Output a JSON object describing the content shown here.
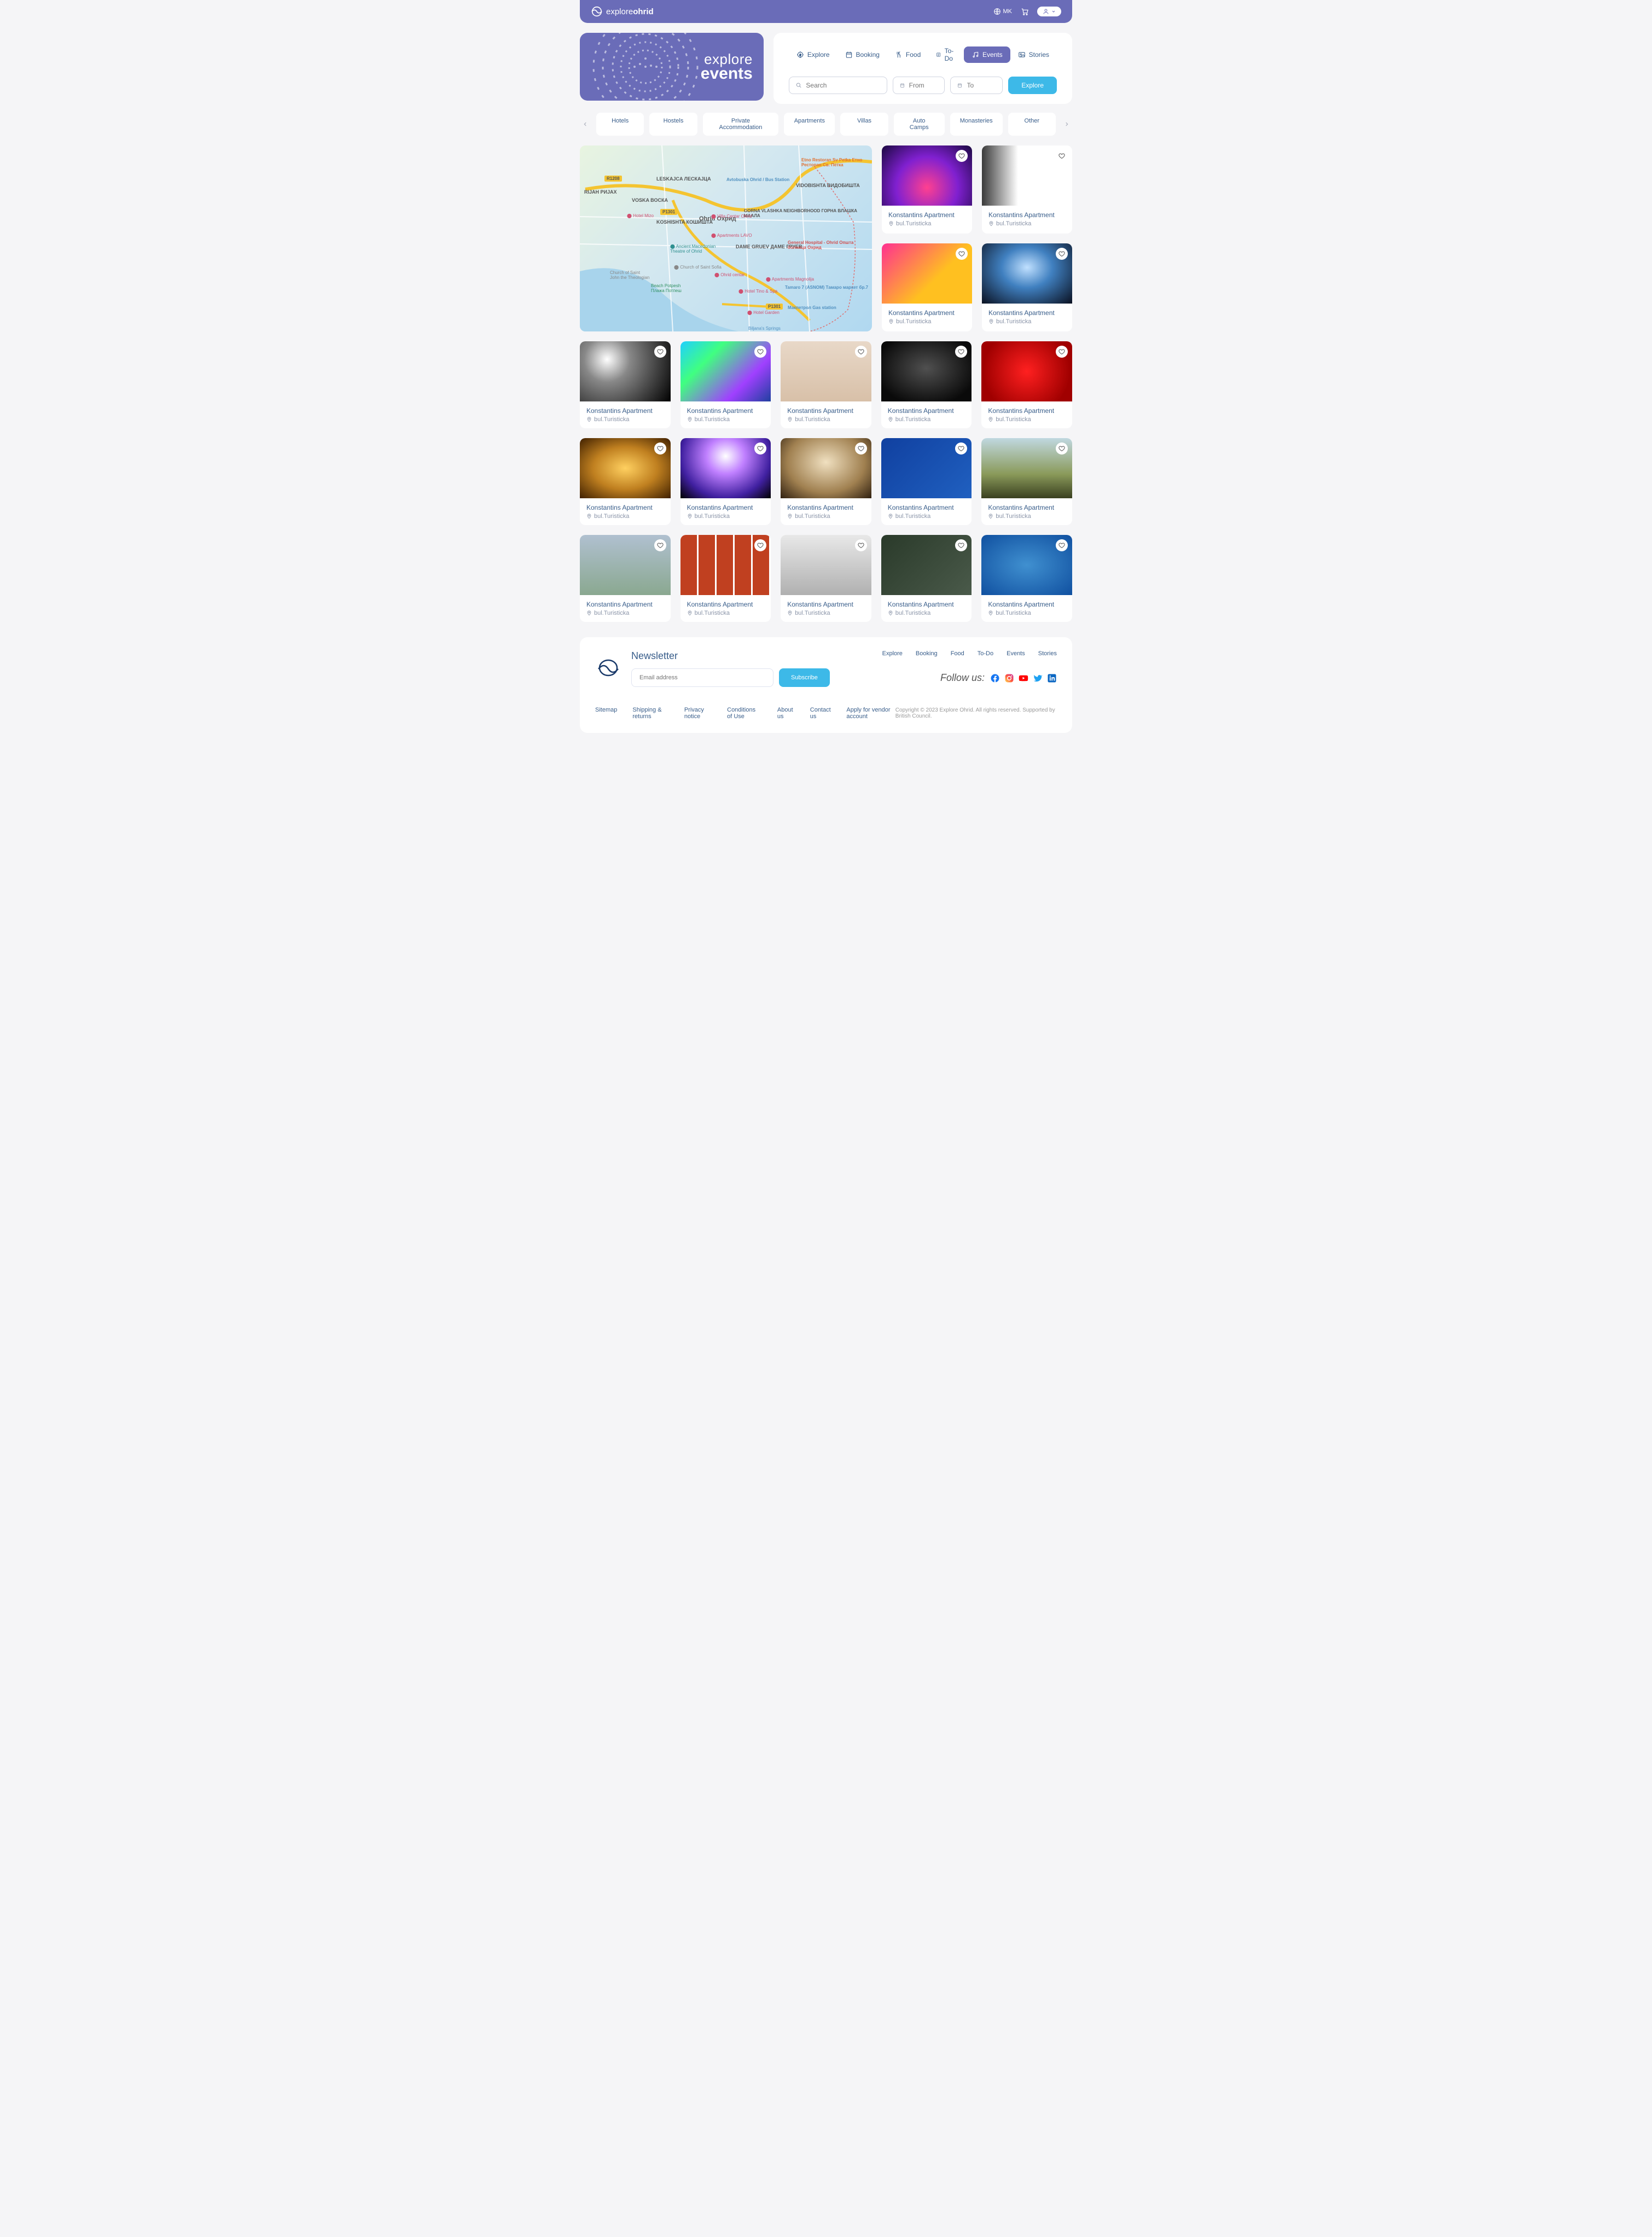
{
  "brand": {
    "prefix": "explore",
    "name": "ohrid"
  },
  "topbar": {
    "lang": "MK"
  },
  "hero": {
    "line1": "explore",
    "line2": "events"
  },
  "nav_tabs": [
    {
      "key": "explore",
      "label": "Explore",
      "icon": "compass"
    },
    {
      "key": "booking",
      "label": "Booking",
      "icon": "calendar"
    },
    {
      "key": "food",
      "label": "Food",
      "icon": "food"
    },
    {
      "key": "todo",
      "label": "To-Do",
      "icon": "list"
    },
    {
      "key": "events",
      "label": "Events",
      "icon": "music",
      "active": true
    },
    {
      "key": "stories",
      "label": "Stories",
      "icon": "image"
    }
  ],
  "search": {
    "placeholder": "Search",
    "from_placeholder": "From",
    "to_placeholder": "To",
    "button": "Explore"
  },
  "chips": [
    "Hotels",
    "Hostels",
    "Private Accommodation",
    "Apartments",
    "Villas",
    "Auto Camps",
    "Monasteries",
    "Other"
  ],
  "map_labels": {
    "ohrid": "Ohrid\nОхрид",
    "leskajca": "LESKAJCA\nЛЕСКАЈЦА",
    "voska": "VOSKA\nВОСКА",
    "koshishta": "KOSHISHTA\nКОШИШТА",
    "vidobishta": "VIDOBISHTA\nВИДОБИШТА",
    "rijah": "RIJAH\nРИЈАХ",
    "gorna": "GORNA VLASHKA\nNEIGHBORHOOD\nГОРНА ВЛАШКА\nМААЛА",
    "dame": "DAME GRUEV\nДАМЕ ГРУЕВ",
    "bus": "Avtobuska Ohrid\n/ Bus Station",
    "restoran": "Etno Restoran Sv Petka\nЕтно Ресторан Св. Петка",
    "hospital": "General Hospital - Ohrid\nОпшта болница Охрид",
    "tamaro": "Tamaro 7 (ASNOM)\nТамаро маркет бр.7",
    "makpetrol": "Макпетрол\nGas station",
    "r1208": "R1208",
    "p1301a": "P1301",
    "p1301b": "P1301"
  },
  "map_pins": {
    "mizo": "Hotel Mizo",
    "villa": "Villa Centar Ohrid",
    "lavo": "Apartments LAVO",
    "theatre": "Ancient Macedonian\nTheatre of Ohrid",
    "sofia": "Church of Saint Sofia",
    "john": "Church of Saint\nJohn the Theologian",
    "potpesh": "Beach Potpesh\nПлажа Потпеш",
    "centar": "Ohrid centar",
    "magnolija": "Apartments Magnolija",
    "tino": "Hotel Tino & Spa",
    "garden": "Hotel Garden",
    "biljana": "Biljana's Springs"
  },
  "card": {
    "title": "Konstantins Apartment",
    "location": "bul.Turisticka"
  },
  "footer": {
    "newsletter_title": "Newsletter",
    "email_placeholder": "Email address",
    "subscribe": "Subscribe",
    "nav": [
      "Explore",
      "Booking",
      "Food",
      "To-Do",
      "Events",
      "Stories"
    ],
    "follow": "Follow us:",
    "links": [
      "Sitemap",
      "Shipping & returns",
      "Privacy notice",
      "Conditions of Use",
      "About us",
      "Contact us",
      "Apply for vendor account"
    ],
    "copyright": "Copyright © 2023 Explore Ohrid. All rights reserved. Supported by British Council."
  },
  "colors": {
    "primary": "#6a6cb8",
    "accent": "#3db9e8",
    "link": "#385d8a"
  }
}
